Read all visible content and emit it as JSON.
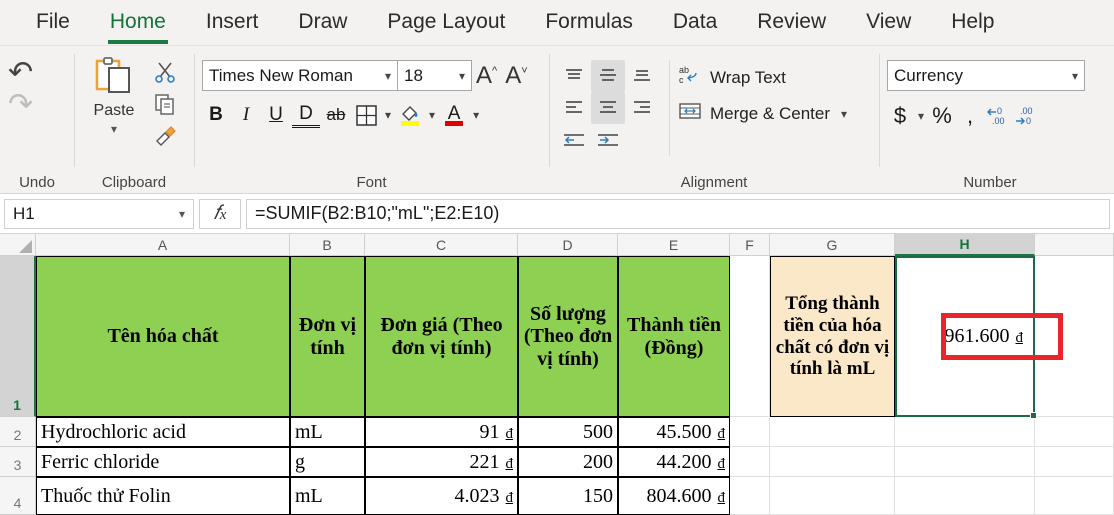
{
  "ribbon": {
    "tabs": [
      {
        "label": "File",
        "active": false
      },
      {
        "label": "Home",
        "active": true
      },
      {
        "label": "Insert",
        "active": false
      },
      {
        "label": "Draw",
        "active": false
      },
      {
        "label": "Page Layout",
        "active": false
      },
      {
        "label": "Formulas",
        "active": false
      },
      {
        "label": "Data",
        "active": false
      },
      {
        "label": "Review",
        "active": false
      },
      {
        "label": "View",
        "active": false
      },
      {
        "label": "Help",
        "active": false
      }
    ],
    "groups": {
      "undo": {
        "label": "Undo",
        "undo_icon": "undo-arrow-icon",
        "redo_icon": "redo-arrow-icon"
      },
      "clipboard": {
        "label": "Clipboard",
        "paste_label": "Paste",
        "paste_icon": "paste-clipboard-icon",
        "cut_icon": "scissors-icon",
        "copy_icon": "copy-icon",
        "format_painter_icon": "format-painter-icon"
      },
      "font": {
        "label": "Font",
        "font_name": "Times New Roman",
        "font_size": "18",
        "grow_font": "A",
        "shrink_font": "A",
        "bold": "B",
        "italic": "I",
        "underline": "U",
        "double_underline": "D",
        "strikethrough": "ab",
        "borders_icon": "borders-grid-icon",
        "fill_color_icon": "fill-bucket-icon",
        "fill_color": "#ffff00",
        "font_color_icon": "font-color-icon",
        "font_color": "#e00000"
      },
      "alignment": {
        "label": "Alignment",
        "wrap_text": "Wrap Text",
        "wrap_text_icon": "wrap-text-icon",
        "merge_center": "Merge & Center",
        "merge_center_icon": "merge-cells-icon",
        "align_top_icon": "align-top-icon",
        "align_middle_icon": "align-middle-icon",
        "align_bottom_icon": "align-bottom-icon",
        "align_left_icon": "align-left-icon",
        "align_center_icon": "align-center-icon",
        "align_right_icon": "align-right-icon",
        "decrease_indent_icon": "decrease-indent-icon",
        "increase_indent_icon": "increase-indent-icon"
      },
      "number": {
        "label": "Number",
        "format": "Currency",
        "accounting": "$",
        "percent": "%",
        "comma": "'",
        "increase_decimal_icon": "increase-decimal-icon",
        "decrease_decimal_icon": "decrease-decimal-icon"
      }
    }
  },
  "formula_bar": {
    "name_box": "H1",
    "fx_label": "fx",
    "formula": "=SUMIF(B2:B10;\"mL\";E2:E10)"
  },
  "sheet": {
    "column_headers": [
      "A",
      "B",
      "C",
      "D",
      "E",
      "F",
      "G",
      "H"
    ],
    "selected_column": "H",
    "row_headers": [
      "1",
      "2",
      "3",
      "4"
    ],
    "selected_row": "1",
    "selected_cell": "H1",
    "header_fill": "#8ed051",
    "note_fill": "#fbe8c8",
    "selection_color": "#1d6b44",
    "highlight_color": "#e8252a",
    "currency_symbol": "đ",
    "table_headers": {
      "a": "Tên hóa chất",
      "b": "Đơn vị tính",
      "c": "Đơn giá (Theo đơn vị tính)",
      "d": "Số lượng (Theo đơn vị tính)",
      "e": "Thành tiền (Đồng)",
      "g": "Tổng thành tiền của hóa chất có đơn vị tính là mL",
      "h": "961.600"
    },
    "rows": [
      {
        "num": "2",
        "name": "Hydrochloric acid",
        "unit": "mL",
        "price": "91",
        "qty": "500",
        "total": "45.500"
      },
      {
        "num": "3",
        "name": "Ferric chloride",
        "unit": "g",
        "price": "221",
        "qty": "200",
        "total": "44.200"
      },
      {
        "num": "4",
        "name": "Thuốc thử Folin",
        "unit": "mL",
        "price": "4.023",
        "qty": "150",
        "total": "804.600"
      }
    ]
  }
}
